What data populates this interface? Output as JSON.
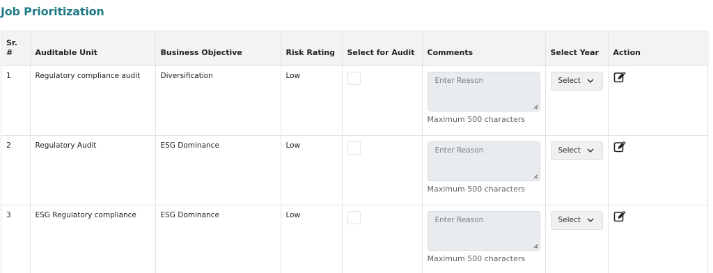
{
  "page": {
    "title": "Job Prioritization"
  },
  "table": {
    "headers": {
      "sr": "Sr. #",
      "unit": "Auditable Unit",
      "objective": "Business Objective",
      "risk": "Risk Rating",
      "select_audit": "Select for Audit",
      "comments": "Comments",
      "year": "Select Year",
      "action": "Action"
    },
    "rows": [
      {
        "sr": "1",
        "unit": "Regulatory compliance audit",
        "objective": "Diversification",
        "risk": "Low",
        "selected": false,
        "comment_placeholder": "Enter Reason",
        "comment_hint": "Maximum 500 characters",
        "year": "Select"
      },
      {
        "sr": "2",
        "unit": "Regulatory Audit",
        "objective": "ESG Dominance",
        "risk": "Low",
        "selected": false,
        "comment_placeholder": "Enter Reason",
        "comment_hint": "Maximum 500 characters",
        "year": "Select"
      },
      {
        "sr": "3",
        "unit": "ESG Regulatory compliance",
        "objective": "ESG Dominance",
        "risk": "Low",
        "selected": false,
        "comment_placeholder": "Enter Reason",
        "comment_hint": "Maximum 500 characters",
        "year": "Select"
      }
    ]
  },
  "icons": {
    "action": "edit-icon",
    "dropdown": "chevron-down-icon"
  },
  "colors": {
    "title": "#1f7a85",
    "header_bg": "#f3f3f3",
    "textarea_bg": "#e9ecef"
  }
}
